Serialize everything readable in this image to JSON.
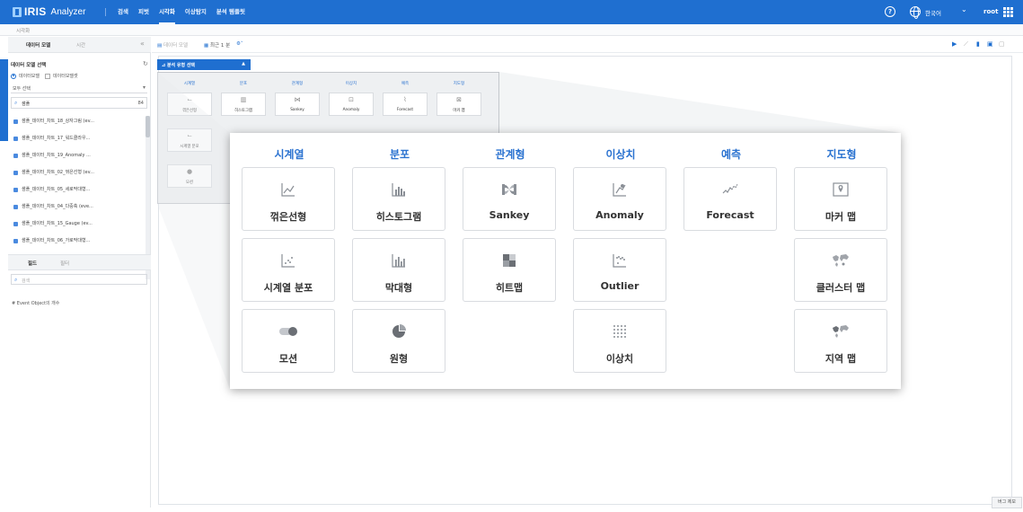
{
  "app": {
    "logo_brand": "IRIS",
    "logo_product": "Analyzer",
    "nav": [
      "검색",
      "피벗",
      "시각화",
      "이상탐지",
      "분석 템플릿"
    ],
    "nav_active": "시각화",
    "language": "한국어",
    "user": "root"
  },
  "breadcrumb": "시각화",
  "left_panel": {
    "tabs": [
      "데이터 모델",
      "시간"
    ],
    "section_title": "데이터 모델 선택",
    "radio_label": "데이터모델",
    "checkbox_label": "데이터모델셋",
    "select_value": "모두 선택",
    "search_value": "샘플",
    "search_count": "84",
    "models": [
      "샘플_데이터_차트_18_상자그림 (ev...",
      "샘플_데이터_차트_17_워드클라우...",
      "샘플_데이터_차트_19_Anomaly ...",
      "샘플_데이터_차트_02_꺾은선형 (ev...",
      "샘플_데이터_차트_05_세로막대형...",
      "샘플_데이터_차트_04_다중축 (eve...",
      "샘플_데이터_차트_15_Gauge (ev...",
      "샘플_데이터_차트_06_가로막대형..."
    ],
    "tabs2": [
      "필드",
      "필터"
    ],
    "field_search_placeholder": "검색",
    "field_item": "Event Object의 개수"
  },
  "toolbar": {
    "data_model": "데이터 모델",
    "time_range": "최근 1 분",
    "settings_icon": "gear-icon"
  },
  "chart_select": {
    "label": "분석 유형 선택"
  },
  "chart_types": {
    "columns": [
      {
        "header": "시계열",
        "cards": [
          {
            "label": "꺾은선형",
            "icon": "line-chart-icon"
          },
          {
            "label": "시계열 분포",
            "icon": "timeseries-scatter-icon"
          },
          {
            "label": "모션",
            "icon": "motion-icon"
          }
        ]
      },
      {
        "header": "분포",
        "cards": [
          {
            "label": "히스토그램",
            "icon": "histogram-icon"
          },
          {
            "label": "막대형",
            "icon": "bar-chart-icon"
          },
          {
            "label": "원형",
            "icon": "pie-chart-icon"
          }
        ]
      },
      {
        "header": "관계형",
        "cards": [
          {
            "label": "Sankey",
            "icon": "sankey-icon"
          },
          {
            "label": "히트맵",
            "icon": "heatmap-icon"
          }
        ]
      },
      {
        "header": "이상치",
        "cards": [
          {
            "label": "Anomaly",
            "icon": "anomaly-icon"
          },
          {
            "label": "Outlier",
            "icon": "outlier-icon"
          },
          {
            "label": "이상치",
            "icon": "dot-matrix-icon"
          }
        ]
      },
      {
        "header": "예측",
        "cards": [
          {
            "label": "Forecast",
            "icon": "forecast-icon"
          }
        ]
      },
      {
        "header": "지도형",
        "cards": [
          {
            "label": "마커 맵",
            "icon": "marker-map-icon"
          },
          {
            "label": "클러스터 맵",
            "icon": "cluster-map-icon"
          },
          {
            "label": "지역 맵",
            "icon": "region-map-icon"
          }
        ]
      }
    ]
  },
  "bug_report": "버그 제보",
  "colors": {
    "brand": "#1f6fd0",
    "header_text": "#2a72d0"
  }
}
